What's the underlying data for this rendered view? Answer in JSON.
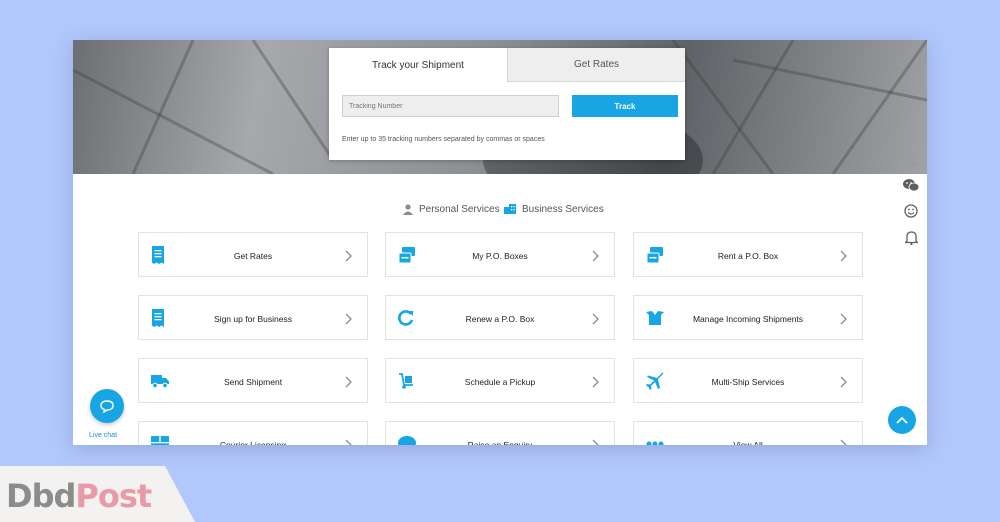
{
  "track_panel": {
    "tabs": [
      "Track your Shipment",
      "Get Rates"
    ],
    "input_placeholder": "Tracking Number",
    "track_button": "Track",
    "hint": "Enter up to 35 tracking numbers separated by commas or spaces"
  },
  "services_toggle": {
    "personal": "Personal Services",
    "business": "Business Services"
  },
  "service_cards": [
    {
      "label": "Get Rates",
      "icon": "receipt-icon"
    },
    {
      "label": "My P.O. Boxes",
      "icon": "po-box-icon"
    },
    {
      "label": "Rent a P.O. Box",
      "icon": "po-box-icon"
    },
    {
      "label": "Sign up for Business",
      "icon": "receipt-icon"
    },
    {
      "label": "Renew a P.O. Box",
      "icon": "renew-icon"
    },
    {
      "label": "Manage Incoming Shipments",
      "icon": "open-box-icon"
    },
    {
      "label": "Send Shipment",
      "icon": "truck-icon"
    },
    {
      "label": "Schedule a Pickup",
      "icon": "dolly-icon"
    },
    {
      "label": "Multi-Ship Services",
      "icon": "plane-icon"
    },
    {
      "label": "Courier Licensing",
      "icon": "box-icon"
    },
    {
      "label": "Raise an Enquiry",
      "icon": "chat-bubble-icon"
    },
    {
      "label": "View All",
      "icon": "dots-icon"
    }
  ],
  "side_toolbar": [
    "share-icon",
    "group-icon",
    "wechat-icon",
    "smiley-icon",
    "bell-icon"
  ],
  "live_chat_label": "Live chat",
  "watermark": {
    "part1": "Dbd",
    "part2": "Post"
  },
  "colors": {
    "accent": "#17a6e3",
    "page_background": "#b2c7fb"
  }
}
